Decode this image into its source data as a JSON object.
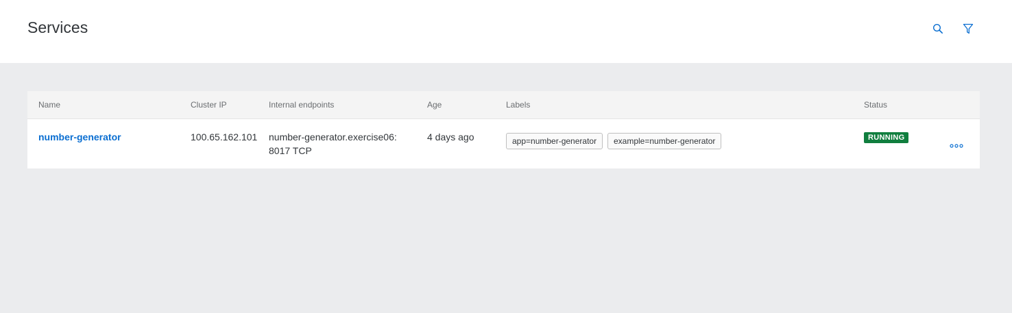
{
  "header": {
    "title": "Services",
    "search_icon": "search-icon",
    "filter_icon": "filter-icon"
  },
  "table": {
    "columns": [
      "Name",
      "Cluster IP",
      "Internal endpoints",
      "Age",
      "Labels",
      "Status"
    ],
    "rows": [
      {
        "name": "number-generator",
        "cluster_ip": "100.65.162.101",
        "endpoint_line1": "number-generator.exercise06:",
        "endpoint_line2": "8017 TCP",
        "age": "4 days ago",
        "labels": [
          "app=number-generator",
          "example=number-generator"
        ],
        "status": "RUNNING",
        "actions_icon": "more-horizontal-icon"
      }
    ]
  },
  "colors": {
    "link": "#0a6ed1",
    "status_running": "#107e3e",
    "page_background": "#ebecee"
  }
}
